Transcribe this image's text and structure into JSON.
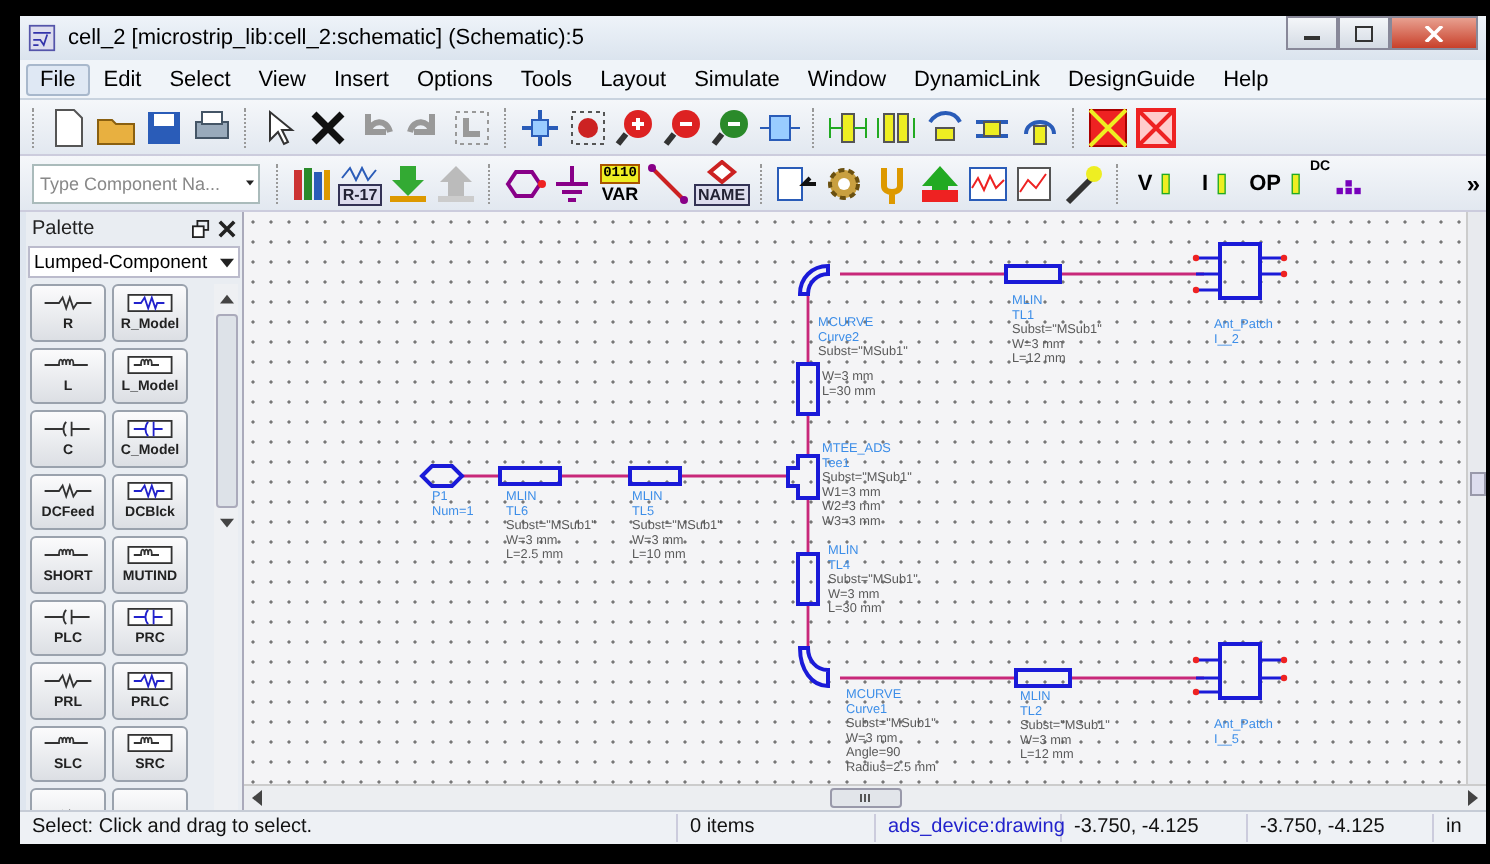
{
  "window": {
    "title": "cell_2 [microstrip_lib:cell_2:schematic] (Schematic):5"
  },
  "menu": [
    {
      "label": "File",
      "selected": true
    },
    {
      "label": "Edit",
      "selected": false
    },
    {
      "label": "Select",
      "selected": false
    },
    {
      "label": "View",
      "selected": false
    },
    {
      "label": "Insert",
      "selected": false
    },
    {
      "label": "Options",
      "selected": false
    },
    {
      "label": "Tools",
      "selected": false
    },
    {
      "label": "Layout",
      "selected": false
    },
    {
      "label": "Simulate",
      "selected": false
    },
    {
      "label": "Window",
      "selected": false
    },
    {
      "label": "DynamicLink",
      "selected": false
    },
    {
      "label": "DesignGuide",
      "selected": false
    },
    {
      "label": "Help",
      "selected": false
    }
  ],
  "toolbar2": {
    "search": {
      "placeholder": "Type Component Na..."
    },
    "labels": [
      "R-17",
      "0110",
      "VAR",
      "NAME",
      "V",
      "I",
      "OP",
      "DC",
      "»"
    ]
  },
  "palette": {
    "title": "Palette",
    "library": "Lumped-Component",
    "items": [
      "R",
      "R_Model",
      "L",
      "L_Model",
      "C",
      "C_Model",
      "DCFeed",
      "DCBlck",
      "SHORT",
      "MUTIND",
      "PLC",
      "PRC",
      "PRL",
      "PRLC",
      "SLC",
      "SRC"
    ]
  },
  "schematic": {
    "components": [
      {
        "kind": "bend",
        "lines": [
          "MCURVE",
          "Curve2",
          "Subst=\"MSub1\""
        ]
      },
      {
        "kind": "line",
        "lines": [
          "MLIN",
          "TL1",
          "Subst=\"MSub1\"",
          "W=3 mm",
          "L=12 mm"
        ]
      },
      {
        "kind": "patch",
        "lines": [
          "Ant_Patch",
          "I__2"
        ]
      },
      {
        "kind": "vline",
        "lines": [
          "W=3 mm",
          "L=30 mm"
        ]
      },
      {
        "kind": "tee",
        "lines": [
          "MTEE_ADS",
          "Tee1",
          "Subst=\"MSub1\"",
          "W1=3 mm",
          "W2=3 mm",
          "W3=3 mm"
        ]
      },
      {
        "kind": "port",
        "lines": [
          "P1",
          "Num=1"
        ]
      },
      {
        "kind": "line",
        "lines": [
          "MLIN",
          "TL6",
          "Subst=\"MSub1\"",
          "W=3 mm",
          "L=2.5 mm"
        ]
      },
      {
        "kind": "line",
        "lines": [
          "MLIN",
          "TL5",
          "Subst=\"MSub1\"",
          "W=3 mm",
          "L=10 mm"
        ]
      },
      {
        "kind": "vline",
        "lines": [
          "MLIN",
          "TL4",
          "Subst=\"MSub1\"",
          "W=3 mm",
          "L=30 mm"
        ]
      },
      {
        "kind": "bend",
        "lines": [
          "MCURVE",
          "Curve1",
          "Subst=\"MSub1\"",
          "W=3 mm",
          "Angle=90",
          "Radius=2.5 mm"
        ]
      },
      {
        "kind": "line",
        "lines": [
          "MLIN",
          "TL2",
          "Subst=\"MSub1\"",
          "W=3 mm",
          "L=12 mm"
        ]
      },
      {
        "kind": "patch",
        "lines": [
          "Ant_Patch",
          "I__5"
        ]
      }
    ]
  },
  "status_bar": [
    {
      "kind": "message",
      "text": "Select: Click and drag to select."
    },
    {
      "kind": "count",
      "text": "0 items"
    },
    {
      "kind": "layer",
      "text": "ads_device:drawing"
    },
    {
      "kind": "coords",
      "text": "-3.750, -4.125"
    },
    {
      "kind": "coords",
      "text": "-3.750, -4.125"
    },
    {
      "kind": "unit",
      "text": "in"
    }
  ]
}
